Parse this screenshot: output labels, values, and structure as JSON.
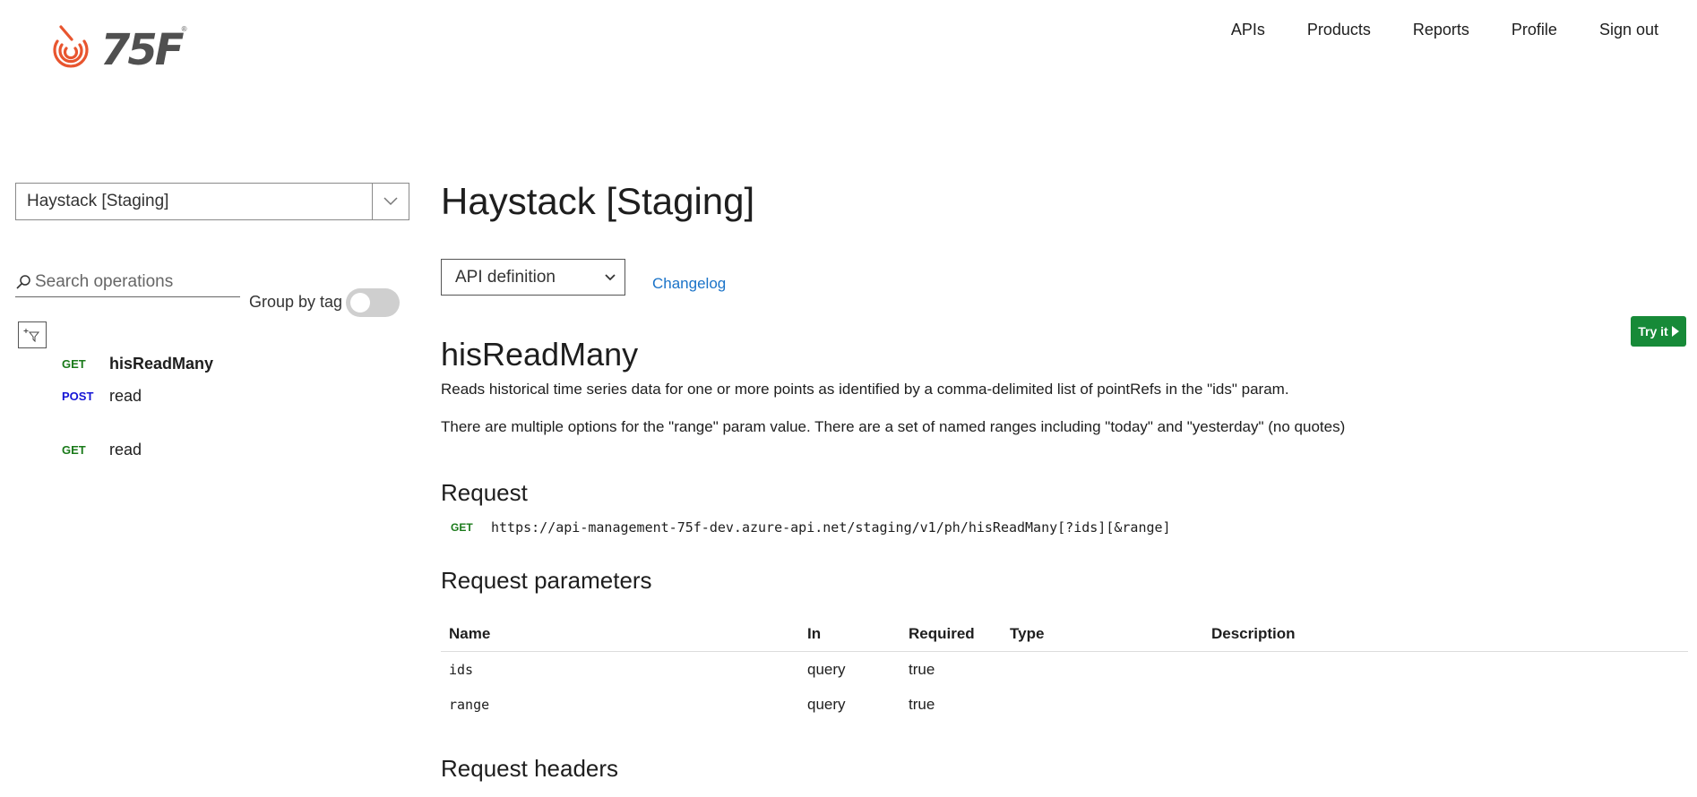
{
  "brand": {
    "logo_text": "75F",
    "logo_reg": "®",
    "accent": "#e8552f"
  },
  "nav": {
    "items": [
      "APIs",
      "Products",
      "Reports",
      "Profile",
      "Sign out"
    ]
  },
  "sidebar": {
    "api_select": "Haystack [Staging]",
    "search_placeholder": "Search operations",
    "group_by_tag_label": "Group by tag",
    "group_by_tag_on": false,
    "operations": [
      {
        "method": "GET",
        "name": "hisReadMany",
        "active": true
      },
      {
        "method": "POST",
        "name": "read",
        "active": false
      },
      {
        "method": "GET",
        "name": "read",
        "active": false
      }
    ]
  },
  "main": {
    "title": "Haystack [Staging]",
    "definition_select": "API definition",
    "changelog": "Changelog",
    "try_it": "Try it",
    "operation_title": "hisReadMany",
    "description_1": "Reads historical time series data for one or more points as identified by a comma-delimited list of pointRefs in the \"ids\" param.",
    "description_2": "There are multiple options for the \"range\" param value. There are a set of named ranges including \"today\" and \"yesterday\" (no quotes)",
    "request_heading": "Request",
    "request_method": "GET",
    "request_url": "https://api-management-75f-dev.azure-api.net/staging/v1/ph/hisReadMany[?ids][&range]",
    "params_heading": "Request parameters",
    "params_columns": [
      "Name",
      "In",
      "Required",
      "Type",
      "Description"
    ],
    "params_rows": [
      {
        "name": "ids",
        "in": "query",
        "required": "true",
        "type": "",
        "description": ""
      },
      {
        "name": "range",
        "in": "query",
        "required": "true",
        "type": "",
        "description": ""
      }
    ],
    "headers_heading": "Request headers"
  }
}
